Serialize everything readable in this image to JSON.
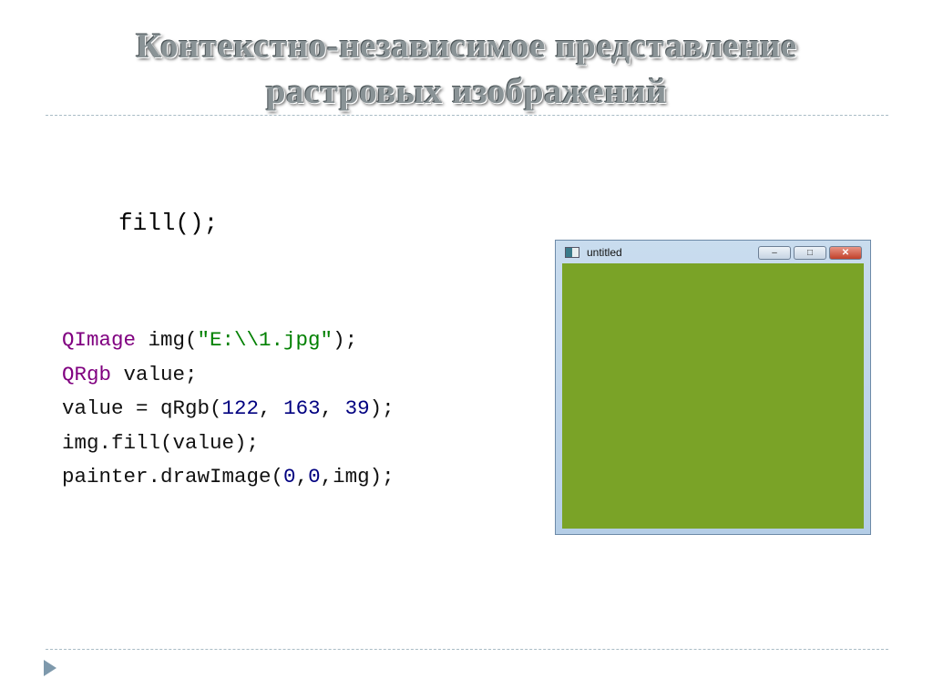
{
  "slide": {
    "title_line1": "Контекстно-независимое представление",
    "title_line2": "растровых изображений",
    "fill_call": "fill();",
    "code": {
      "l1": [
        "QImage",
        " img(",
        "\"E:\\\\1.jpg\"",
        ");"
      ],
      "l2": [
        "QRgb",
        " value;"
      ],
      "l3": [
        "value = qRgb(",
        "122",
        ", ",
        "163",
        ", ",
        "39",
        ");"
      ],
      "l4": "img.fill(value);",
      "l5": [
        "painter.drawImage(",
        "0",
        ",",
        "0",
        ",img);"
      ]
    },
    "window": {
      "title": "untitled",
      "minimize": "–",
      "maximize": "□",
      "close": "✕",
      "fill_color": "#7aa327"
    }
  }
}
